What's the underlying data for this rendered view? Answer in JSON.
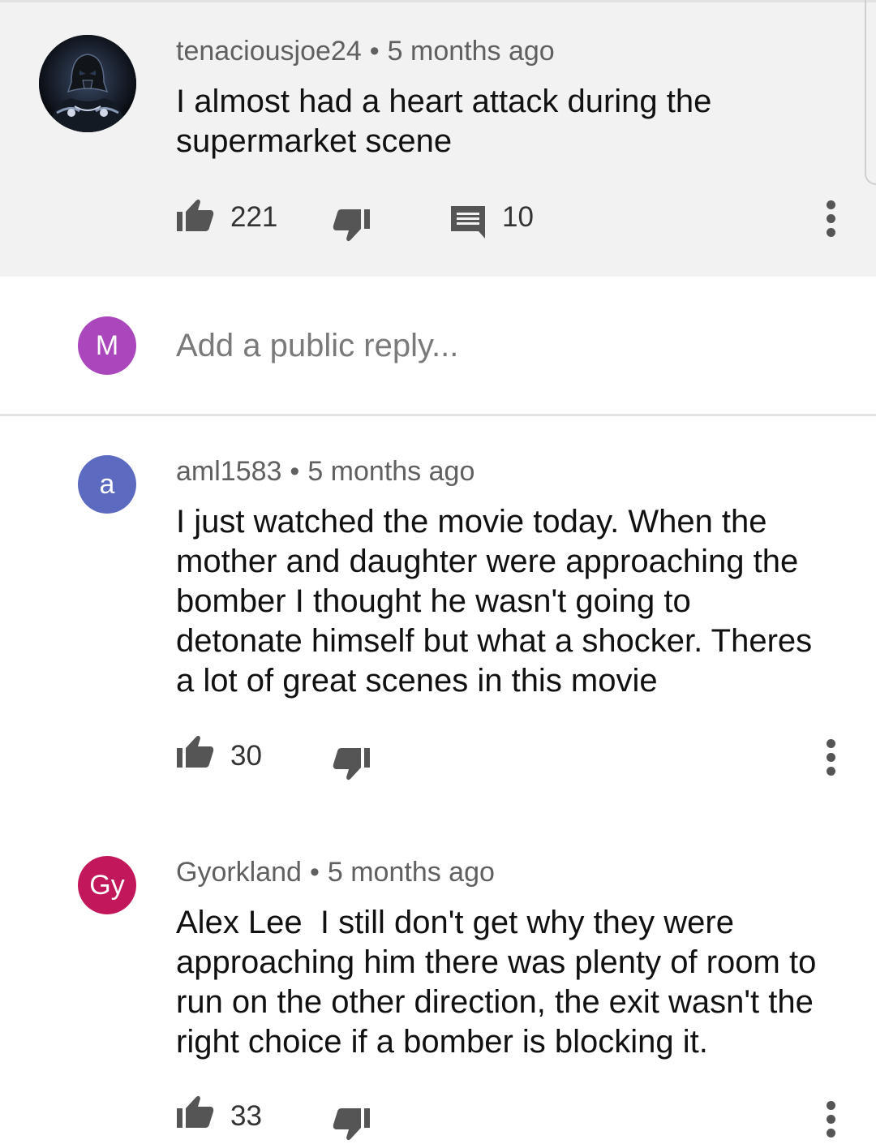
{
  "comments": [
    {
      "author": "tenaciousjoe24",
      "time": "5 months ago",
      "text": "I almost had a heart attack during the supermarket scene",
      "likes": "221",
      "replies": "10"
    },
    {
      "author": "aml1583",
      "time": "5 months ago",
      "avatar_letter": "a",
      "avatar_color": "#5c6bc0",
      "text": "I just watched the movie today. When the mother and daughter were approaching the bomber I thought he wasn't going to detonate himself but what a shocker. Theres a lot of great scenes in this movie",
      "likes": "30"
    },
    {
      "author": "Gyorkland",
      "time": "5 months ago",
      "avatar_letter": "Gy",
      "avatar_color": "#c2185b",
      "text": "Alex Lee  I still don't get why they were approaching him there was plenty of room to run on the other direction, the exit wasn't the right choice if a bomber is blocking it.",
      "likes": "33"
    }
  ],
  "reply_box": {
    "avatar_letter": "M",
    "avatar_color": "#ab47bc",
    "placeholder": "Add a public reply..."
  },
  "separator": "•",
  "icons": {
    "like": "thumbs-up-icon",
    "dislike": "thumbs-down-icon",
    "reply": "comment-icon",
    "more": "more-vert-icon"
  }
}
